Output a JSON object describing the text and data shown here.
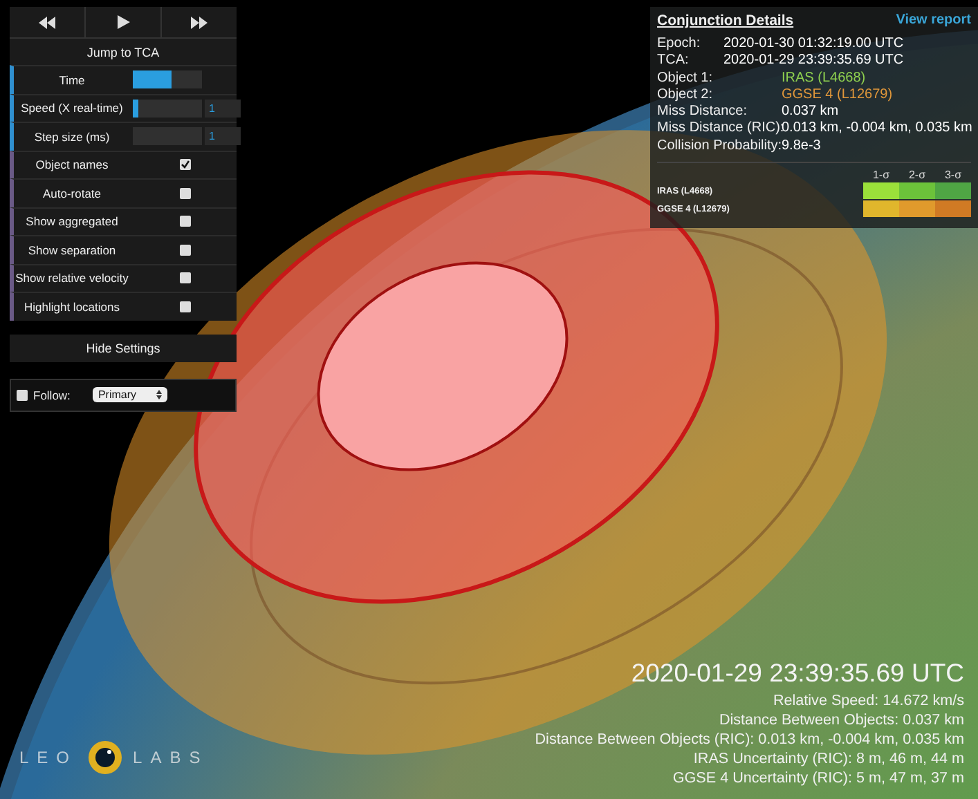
{
  "playback": [
    {
      "kind": "rewind"
    },
    {
      "kind": "play"
    },
    {
      "kind": "fast-forward"
    }
  ],
  "jump_button": "Jump to TCA",
  "sliders": [
    {
      "label": "Time",
      "level": 0.55
    },
    {
      "label": "Speed (X real-time)",
      "level": 0.08,
      "value": "1"
    },
    {
      "label": "Step size (ms)",
      "level": 0,
      "value": "1"
    }
  ],
  "toggles": [
    {
      "label": "Object names",
      "checked": true
    },
    {
      "label": "Auto-rotate",
      "checked": false
    },
    {
      "label": "Show aggregated",
      "checked": false
    },
    {
      "label": "Show separation",
      "checked": false
    },
    {
      "label": "Show relative velocity",
      "checked": false
    },
    {
      "label": "Highlight locations",
      "checked": false
    }
  ],
  "hide_button": "Hide Settings",
  "follow": {
    "label": "Follow:",
    "checked": false,
    "select": "Primary"
  },
  "details": {
    "title": "Conjunction Details",
    "link": "View report",
    "fields": [
      {
        "label": "Epoch:",
        "value": "2020-01-30 01:32:19.00 UTC",
        "color": "#ffffff",
        "kind": "timestamp"
      },
      {
        "label": "TCA:",
        "value": "2020-01-29 23:39:35.69 UTC",
        "color": "#ffffff",
        "kind": "timestamp"
      },
      {
        "label": "Object 1:",
        "value": "IRAS (L4668)",
        "color": "#8fd14f",
        "kind": "plain"
      },
      {
        "label": "Object 2:",
        "value": "GGSE 4 (L12679)",
        "color": "#e0973a",
        "kind": "plain"
      },
      {
        "label": "Miss Distance:",
        "value": "0.037 km",
        "color": "#ffffff",
        "kind": "plain"
      },
      {
        "label": "Miss Distance (RIC):",
        "value": "0.013 km, -0.004 km, 0.035 km",
        "color": "#ffffff",
        "kind": "plain"
      },
      {
        "label": "Collision Probability:",
        "value": "9.8e-3",
        "color": "#ffffff",
        "kind": "plain"
      }
    ],
    "sigma_columns": [
      "1-σ",
      "2-σ",
      "3-σ"
    ],
    "sigma_rows": [
      {
        "name": "IRAS (L4668)",
        "cells": [
          {
            "color": "#9be03a"
          },
          {
            "color": "#6cc23a"
          },
          {
            "color": "#4fa544"
          }
        ]
      },
      {
        "name": "GGSE 4 (L12679)",
        "cells": [
          {
            "color": "#e0b62c"
          },
          {
            "color": "#e09a2c"
          },
          {
            "color": "#d07a24"
          }
        ]
      }
    ]
  },
  "readout": {
    "time": "2020-01-29 23:39:35.69 UTC",
    "lines": [
      "Relative Speed: 14.672 km/s",
      "Distance Between Objects: 0.037 km",
      "Distance Between Objects (RIC): 0.013 km, -0.004 km, 0.035 km",
      "IRAS Uncertainty (RIC): 8 m, 46 m, 44 m",
      "GGSE 4 Uncertainty (RIC): 5 m, 47 m, 37 m"
    ]
  },
  "logo": {
    "left": "LEO",
    "right": "LABS"
  }
}
